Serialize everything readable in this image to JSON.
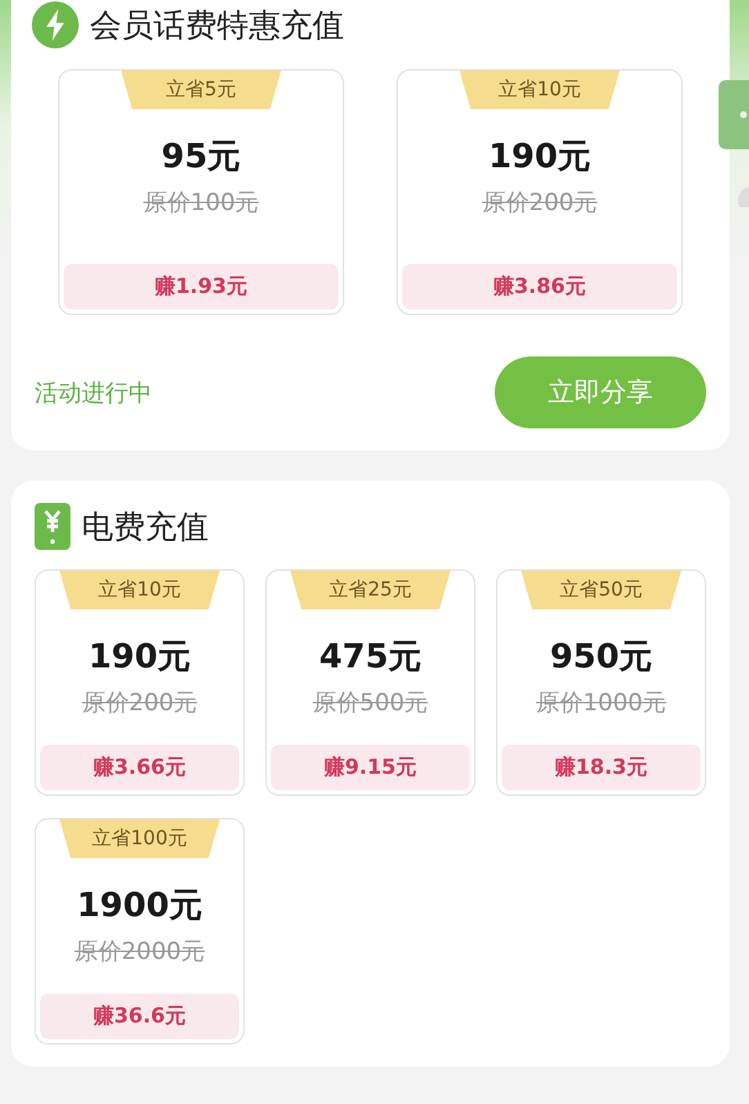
{
  "sections": [
    {
      "kind": "bolt",
      "title": "会员话费特惠充值",
      "items": [
        {
          "badge": "立省5元",
          "price": "95元",
          "original": "原价100元",
          "earn": "赚1.93元"
        },
        {
          "badge": "立省10元",
          "price": "190元",
          "original": "原价200元",
          "earn": "赚3.86元"
        }
      ],
      "footer": {
        "status": "活动进行中",
        "button": "立即分享"
      }
    },
    {
      "kind": "yuan",
      "title": "电费充值",
      "items": [
        {
          "badge": "立省10元",
          "price": "190元",
          "original": "原价200元",
          "earn": "赚3.66元"
        },
        {
          "badge": "立省25元",
          "price": "475元",
          "original": "原价500元",
          "earn": "赚9.15元"
        },
        {
          "badge": "立省50元",
          "price": "950元",
          "original": "原价1000元",
          "earn": "赚18.3元"
        },
        {
          "badge": "立省100元",
          "price": "1900元",
          "original": "原价2000元",
          "earn": "赚36.6元"
        }
      ]
    }
  ]
}
